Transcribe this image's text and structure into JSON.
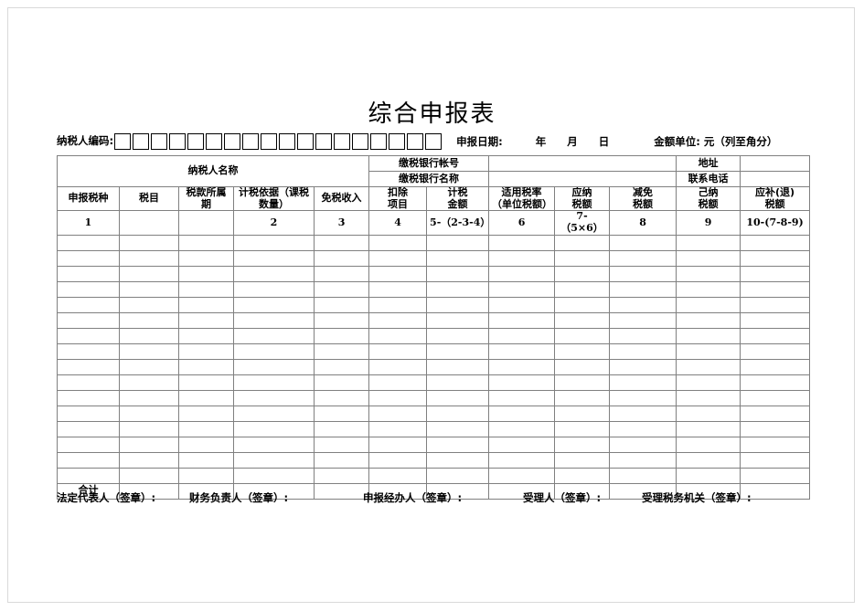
{
  "title": "综合申报表",
  "header": {
    "taxpayer_code_label": "纳税人编码:",
    "code_box_count": 18,
    "declaration_date_label": "申报日期:",
    "year": "年",
    "month": "月",
    "day": "日",
    "amount_unit": "金额单位: 元（列至角分）"
  },
  "info": {
    "taxpayer_name_label": "纳税人名称",
    "taxpayer_name_value": "",
    "bank_account_label": "缴税银行帐号",
    "bank_account_value": "",
    "bank_name_label": "缴税银行名称",
    "bank_name_value": "",
    "address_label": "地址",
    "address_value": "",
    "phone_label": "联系电话",
    "phone_value": ""
  },
  "table": {
    "columns": [
      "申报税种",
      "税目",
      "税款所属期",
      "计税依据（课税数量）",
      "免税收入",
      "扣除\n项目",
      "计税\n金额",
      "适用税率\n（单位税额）",
      "应纳\n税额",
      "减免\n税额",
      "己纳\n税额",
      "应补(退)\n税额"
    ],
    "column_numbers": [
      "1",
      "",
      "",
      "2",
      "3",
      "4",
      "5-（2-3-4）",
      "6",
      "7-（5×6）",
      "8",
      "9",
      "10-(7-8-9)"
    ],
    "empty_row_count": 16,
    "total_label": "合计",
    "total_values": [
      "",
      "",
      "",
      "",
      "",
      "",
      "",
      "",
      "",
      "",
      ""
    ]
  },
  "signatures": [
    "法定代表人（签章）:",
    "财务负责人（签章）:",
    "申报经办人（签章）:",
    "受理人（签章）:",
    "受理税务机关（签章）:"
  ]
}
